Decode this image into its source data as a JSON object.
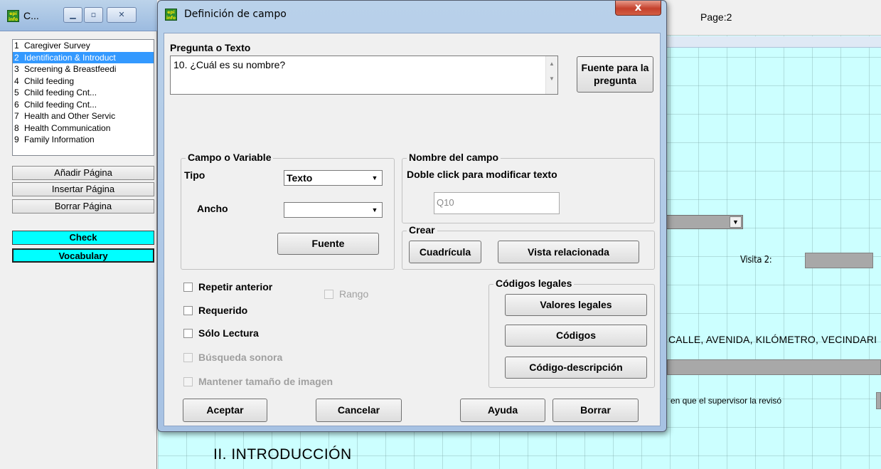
{
  "left_window": {
    "title": "C...",
    "pages": [
      {
        "num": "1",
        "label": "Caregiver Survey"
      },
      {
        "num": "2",
        "label": "Identification & Introduct"
      },
      {
        "num": "3",
        "label": "Screening & Breastfeedi"
      },
      {
        "num": "4",
        "label": "Child feeding"
      },
      {
        "num": "5",
        "label": "Child feeding Cnt..."
      },
      {
        "num": "6",
        "label": "Child feeding Cnt..."
      },
      {
        "num": "7",
        "label": "Health and Other Servic"
      },
      {
        "num": "8",
        "label": "Health Communication"
      },
      {
        "num": "9",
        "label": "Family Information"
      }
    ],
    "selected_index": 1,
    "buttons": {
      "add_page": "Añadir Página",
      "insert_page": "Insertar Página",
      "delete_page": "Borrar Página",
      "check": "Check",
      "vocabulary": "Vocabulary"
    }
  },
  "background": {
    "page_label": "Page:2",
    "visita_label": "Visita 2:",
    "address_text": "CALLE, AVENIDA, KILÓMETRO, VECINDARI",
    "supervisor_text": "en que el supervisor la revisó",
    "section_title": "II. INTRODUCCIÓN"
  },
  "dialog": {
    "title": "Definición de campo",
    "close_glyph": "x",
    "question_label": "Pregunta o Texto",
    "question_value": "10. ¿Cuál es su nombre?",
    "question_font_button": "Fuente para la pregunta",
    "field_group": {
      "legend": "Campo o Variable",
      "type_label": "Tipo",
      "type_value": "Texto",
      "width_label": "Ancho",
      "width_value": "",
      "font_button": "Fuente"
    },
    "name_group": {
      "legend": "Nombre del campo",
      "hint": "Doble click para modificar texto",
      "name_value": "Q10"
    },
    "create_group": {
      "legend": "Crear",
      "grid_button": "Cuadrícula",
      "related_view_button": "Vista relacionada"
    },
    "options": {
      "repeat_previous": "Repetir anterior",
      "range": "Rango",
      "required": "Requerido",
      "read_only": "Sólo Lectura",
      "soundex": "Búsqueda sonora",
      "keep_image_size": "Mantener tamaño de imagen"
    },
    "legal_codes": {
      "legend": "Códigos legales",
      "legal_values_button": "Valores legales",
      "codes_button": "Códigos",
      "code_description_button": "Código-descripción"
    },
    "footer": {
      "accept": "Aceptar",
      "cancel": "Cancelar",
      "help": "Ayuda",
      "delete": "Borrar"
    }
  },
  "colors": {
    "canvas_bg": "#ccffff",
    "selected_row": "#3399ff",
    "cyan_button": "#00ffff"
  }
}
